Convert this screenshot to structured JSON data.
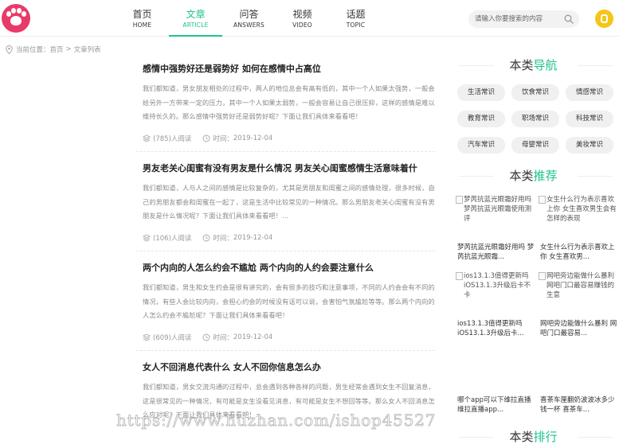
{
  "brand": {
    "logo_color": "#e83a6a",
    "accent": "#1ec292"
  },
  "nav": {
    "items": [
      {
        "cn": "首页",
        "en": "HOME"
      },
      {
        "cn": "文章",
        "en": "ARTICLE"
      },
      {
        "cn": "问答",
        "en": "ANSWERS"
      },
      {
        "cn": "视频",
        "en": "VIDEO"
      },
      {
        "cn": "话题",
        "en": "TOPIC"
      }
    ],
    "active": "文章"
  },
  "search": {
    "placeholder": "请输入你要搜索的内容"
  },
  "breadcrumb": {
    "prefix": "当前位置：",
    "home": "首页",
    "separator": ">",
    "current": "文章列表"
  },
  "articles": [
    {
      "title": "感情中强势好还是弱势好 如何在感情中占高位",
      "summary": "我们都知道，男女朋友相处的过程中，两人的地位总会有高有低的，其中一个人如果太强势，一般会给另外一方带来一定的压力，其中一个人如果太弱势，一般会容易让自己很压抑，这样的感情是难以维持长久的。那么感情中强势好还是弱势好呢？下面让我们具体来看看吧！",
      "reads": "(785)人阅读",
      "time_label": "时间：",
      "date": "2019-12-04"
    },
    {
      "title": "男友老关心闺蜜有没有男友是什么情况 男友关心闺蜜感情生活意味着什",
      "summary": "我们都知道，人与人之间的感情是比较复杂的，尤其是男朋友和闺蜜之间的感情处理，很多时候，自己的男朋友都会和闺蜜在一起了，这是生活中比较常见的一种情况。那么男朋友老关心闺蜜有没有男朋友是什么情况呢？下面让我们具体来看看吧！...",
      "reads": "(106)人阅读",
      "time_label": "时间：",
      "date": "2019-12-04"
    },
    {
      "title": "两个内向的人怎么约会不尴尬 两个内向的人约会要注意什么",
      "summary": "我们都知道，男生和女生约会是很有讲究的，会有很多的技巧和注意事项，不同的人约会会有不同的情况，有些人会比较内向，会担心约会的时候没有话可以说，会害怕气氛尴尬等等。那么两个内向的人怎么约会不尴尬呢？下面让我们具体来看看吧！",
      "reads": "(609)人阅读",
      "time_label": "时间：",
      "date": "2019-12-04"
    },
    {
      "title": "女人不回消息代表什么 女人不回你信息怎么办",
      "summary": "我们都知道，男女交流沟通的过程中，总会遇到各种各样的问题，男生经常会遇到女生不回复消息，这是很常见的一种情况，有可能是女生没看见消息，有可能是女生不想回等等。那么女人不回消息怎么应对呢？下面让我们具体来看看吧！...",
      "reads": "",
      "time_label": "",
      "date": ""
    }
  ],
  "sidebar": {
    "nav_title": {
      "plain": "本类",
      "highlight": "导航"
    },
    "tags": [
      "生活常识",
      "饮食常识",
      "情感常识",
      "教育常识",
      "职场常识",
      "科技常识",
      "汽车常识",
      "母婴常识",
      "美妆常识"
    ],
    "recommend_title": {
      "plain": "本类",
      "highlight": "推荐"
    },
    "recommend": [
      {
        "alt": "梦芮抗蓝光眼霜好用吗 梦芮抗蓝光眼霜使用测评",
        "title": "梦芮抗蓝光眼霜好用吗 梦芮抗蓝光眼霜..."
      },
      {
        "alt": "女生什么行为表示喜欢上你 女生喜欢男生会有怎样的表现",
        "title": "女生什么行为表示喜欢上你 女生喜欢男..."
      },
      {
        "alt": "ios13.1.3值得更新吗 iOS13.1.3升级后卡不卡",
        "title": "ios13.1.3值得更新吗 iOS13.1.3升级后卡..."
      },
      {
        "alt": "网吧旁边能做什么暴利 网吧门口最容易赚钱的生意",
        "title": "网吧旁边能做什么暴利 网吧门口最容易..."
      },
      {
        "alt": "",
        "title": "哪个app可以下维拉直播 维拉直播app..."
      },
      {
        "alt": "",
        "title": "喜茶车厘翻奶波波冰多少钱一杯 喜茶车..."
      }
    ],
    "rank_title": {
      "plain": "本类",
      "highlight": "排行"
    }
  },
  "watermark": "https://www.huzhan.com/ishop45527"
}
